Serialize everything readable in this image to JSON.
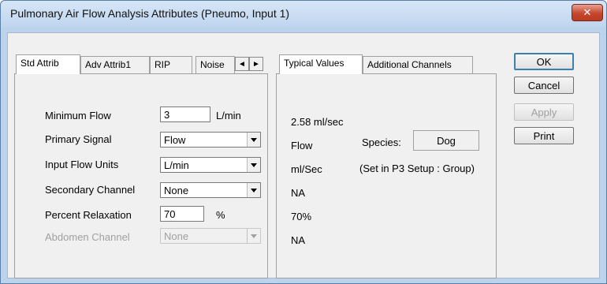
{
  "window": {
    "title": "Pulmonary Air Flow Analysis Attributes  (Pneumo, Input 1)",
    "close_glyph": "✕"
  },
  "left_tabs": [
    {
      "label": "Std Attrib",
      "active": true
    },
    {
      "label": "Adv Attrib1",
      "active": false
    },
    {
      "label": "RIP",
      "active": false
    },
    {
      "label": "Noise",
      "active": false
    }
  ],
  "scroll": {
    "left_glyph": "◄",
    "right_glyph": "►"
  },
  "std_attrib": {
    "minimum_flow": {
      "label": "Minimum Flow",
      "value": "3",
      "unit": "L/min"
    },
    "primary_signal": {
      "label": "Primary Signal",
      "value": "Flow"
    },
    "input_flow_units": {
      "label": "Input Flow Units",
      "value": "L/min"
    },
    "secondary_channel": {
      "label": "Secondary Channel",
      "value": "None"
    },
    "percent_relaxation": {
      "label": "Percent Relaxation",
      "value": "70",
      "unit": "%"
    },
    "abdomen_channel": {
      "label": "Abdomen Channel",
      "value": "None",
      "disabled": true
    }
  },
  "right_tabs": [
    {
      "label": "Typical Values",
      "active": true
    },
    {
      "label": "Additional Channels",
      "active": false
    }
  ],
  "typical_values": {
    "minimum_flow": "2.58 ml/sec",
    "primary_signal": "Flow",
    "input_flow_units": "ml/Sec",
    "secondary_channel": "NA",
    "percent_relaxation": "70%",
    "abdomen_channel": "NA",
    "species_label": "Species:",
    "species_value": "Dog",
    "setup_note": "(Set in P3 Setup : Group)"
  },
  "buttons": {
    "ok": "OK",
    "cancel": "Cancel",
    "apply": "Apply",
    "print": "Print"
  },
  "colors": {
    "accent": "#3c7fb1",
    "close_button": "#c4472e"
  }
}
